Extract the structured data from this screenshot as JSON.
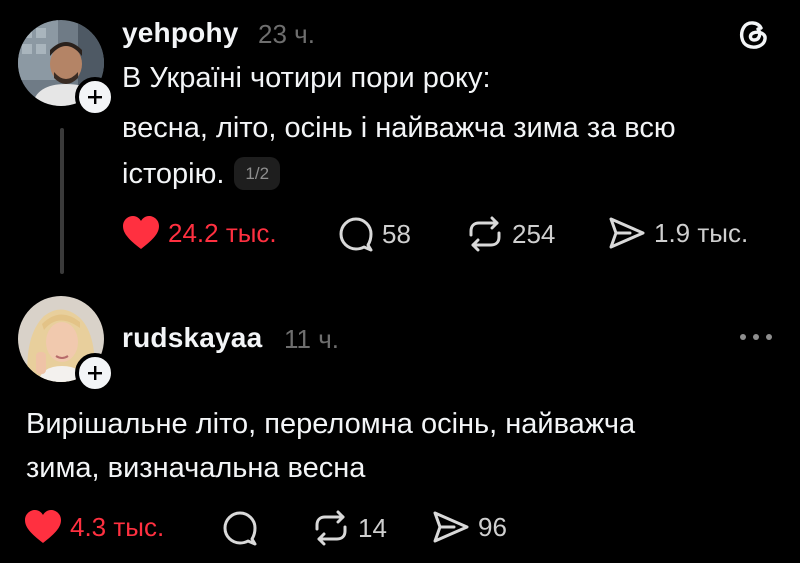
{
  "posts": [
    {
      "username": "yehpohy",
      "time": "23 ч.",
      "lines": [
        "В Україні чотири пори року:",
        "весна, літо, осінь і найважча зима за всю",
        "історію."
      ],
      "page_badge": "1/2",
      "actions": {
        "likes": "24.2 тыс.",
        "replies": "58",
        "reposts": "254",
        "shares": "1.9 тыс."
      },
      "corner_icon": "threads-logo-icon"
    },
    {
      "username": "rudskayaa",
      "time": "11 ч.",
      "lines": [
        "Вирішальне літо, переломна осінь, найважча",
        "зима, визначальна весна"
      ],
      "actions": {
        "likes": "4.3 тыс.",
        "replies": "",
        "reposts": "14",
        "shares": "96"
      },
      "corner_icon": "more-options-icon"
    }
  ],
  "colors": {
    "background": "#000000",
    "text": "#f3f5f7",
    "muted": "#6e6e6e",
    "like": "#ff3040"
  }
}
